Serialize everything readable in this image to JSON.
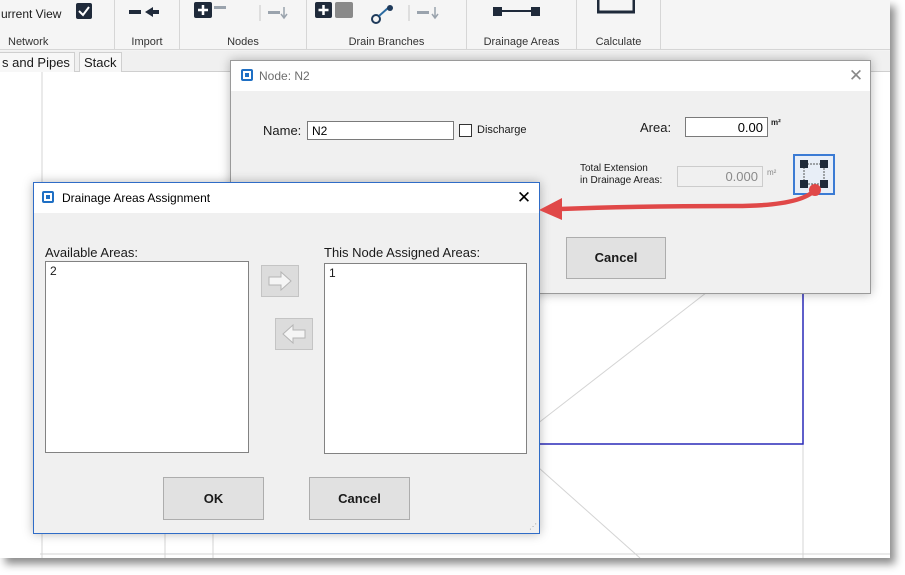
{
  "ribbon": {
    "items": [
      {
        "label": "urrent View"
      }
    ],
    "groups": [
      {
        "label": "Network"
      },
      {
        "label": "Import"
      },
      {
        "label": "Nodes"
      },
      {
        "label": "Drain Branches"
      },
      {
        "label": "Drainage Areas"
      },
      {
        "label": "Calculate"
      }
    ]
  },
  "tabs": [
    {
      "label": "s and Pipes"
    },
    {
      "label": "Stack"
    }
  ],
  "node_dialog": {
    "title": "Node: N2",
    "name_label": "Name:",
    "name_value": "N2",
    "discharge_label": "Discharge",
    "area_label": "Area:",
    "area_value": "0.00",
    "area_unit": "m²",
    "total_extension_label_line1": "Total Extension",
    "total_extension_label_line2": "in Drainage Areas:",
    "total_extension_value": "0.000",
    "total_extension_unit": "m²",
    "cancel_label": "Cancel"
  },
  "assignment_dialog": {
    "title": "Drainage Areas Assignment",
    "available_label": "Available Areas:",
    "available_items": [
      "2"
    ],
    "assigned_label": "This Node Assigned Areas:",
    "assigned_items": [
      "1"
    ],
    "ok_label": "OK",
    "cancel_label": "Cancel"
  },
  "colors": {
    "annotation_arrow": "#e04848",
    "canvas_outline": "#2a2ab8",
    "app_icon": "#1e6fc4"
  }
}
